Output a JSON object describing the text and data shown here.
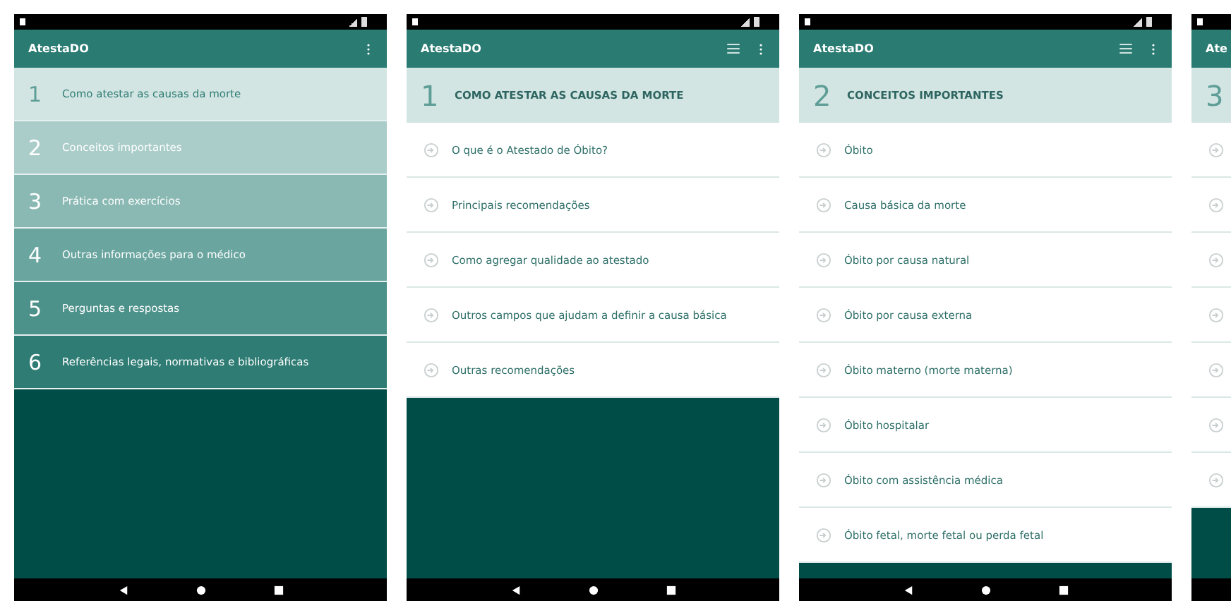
{
  "screens": [
    {
      "kind": "menu",
      "title": "AtestaDO",
      "list_toggle": false,
      "sections": [
        {
          "number": "1",
          "label": "Como atestar as causas da morte",
          "selected": true
        },
        {
          "number": "2",
          "label": "Conceitos importantes",
          "selected": false
        },
        {
          "number": "3",
          "label": "Prática com exercícios",
          "selected": false
        },
        {
          "number": "4",
          "label": "Outras informações para o médico",
          "selected": false
        },
        {
          "number": "5",
          "label": "Perguntas e respostas",
          "selected": false
        },
        {
          "number": "6",
          "label": "Referências legais, normativas e bibliográficas",
          "selected": false
        }
      ]
    },
    {
      "kind": "list",
      "title": "AtestaDO",
      "list_toggle": true,
      "header": {
        "number": "1",
        "label": "COMO ATESTAR AS CAUSAS DA MORTE"
      },
      "items": [
        {
          "kind": "link",
          "label": "O que é o Atestado de Óbito?"
        },
        {
          "kind": "link",
          "label": "Principais recomendações"
        },
        {
          "kind": "link",
          "label": "Como agregar qualidade ao atestado"
        },
        {
          "kind": "link",
          "label": "Outros campos que ajudam a definir a causa básica"
        },
        {
          "kind": "link",
          "label": "Outras recomendações"
        }
      ]
    },
    {
      "kind": "list",
      "title": "AtestaDO",
      "list_toggle": true,
      "header": {
        "number": "2",
        "label": "CONCEITOS IMPORTANTES"
      },
      "items": [
        {
          "kind": "link",
          "label": "Óbito"
        },
        {
          "kind": "link",
          "label": "Causa básica da morte"
        },
        {
          "kind": "link",
          "label": "Óbito por causa natural"
        },
        {
          "kind": "link",
          "label": "Óbito por causa externa"
        },
        {
          "kind": "link",
          "label": "Óbito materno (morte materna)"
        },
        {
          "kind": "link",
          "label": "Óbito hospitalar"
        },
        {
          "kind": "link",
          "label": "Óbito com assistência médica"
        },
        {
          "kind": "link",
          "label": "Óbito fetal, morte fetal ou perda fetal"
        }
      ]
    },
    {
      "kind": "list",
      "title": "Ate",
      "list_toggle": false,
      "header": {
        "number": "3"
      },
      "items": [
        {
          "kind": "link"
        },
        {
          "kind": "link"
        },
        {
          "kind": "link"
        },
        {
          "kind": "link"
        },
        {
          "kind": "link"
        },
        {
          "kind": "link"
        },
        {
          "kind": "link"
        }
      ]
    }
  ]
}
